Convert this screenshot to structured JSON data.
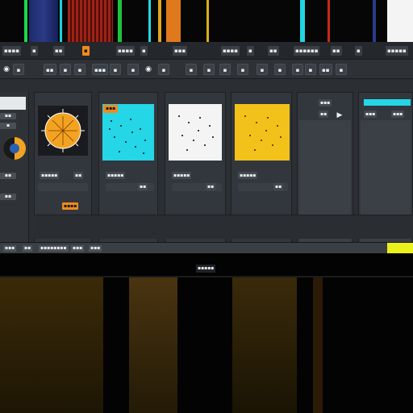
{
  "menubar": {
    "items": [
      "▪▪▪▪",
      "▪",
      "▪▪",
      "▪",
      "▪▪▪▪",
      "▪",
      "▪▪▪",
      "▪▪▪▪",
      "▪",
      "▪▪",
      "▪▪▪▪▪▪",
      "▪▪",
      "▪",
      "▪▪▪▪▪"
    ]
  },
  "toolbar": {
    "buttons": [
      "◉",
      "▪",
      "▪▪",
      "▪",
      "▪",
      "▪▪▪",
      "▪",
      "▪",
      "◉",
      "▪",
      "▪",
      "▪",
      "▪",
      "▪",
      "▪",
      "▪",
      "▪",
      "▪",
      "▪▪",
      "▪"
    ]
  },
  "sidebar": {
    "items": [
      "▪▪",
      "▪",
      "▪▪",
      "▪▪"
    ]
  },
  "panels": {
    "p1": {
      "footer_label": "▪▪▪▪▪",
      "footer_value": "▪▪",
      "action_label": "▪▪▪▪"
    },
    "p2": {
      "header_label": "▪▪▪",
      "footer_label": "▪▪▪▪▪",
      "footer_value": "▪▪"
    },
    "p3": {
      "footer_label": "▪▪▪▪▪",
      "footer_value": "▪▪"
    },
    "p4": {
      "footer_label": "▪▪▪▪▪",
      "footer_value": "▪▪"
    },
    "p5": {
      "header_label": "▪▪▪",
      "sub_label": "▪▪"
    },
    "p6": {
      "header_label": "▪▪▪",
      "sub_label": "▪▪▪"
    }
  },
  "statusbar": {
    "items": [
      "▪▪▪",
      "▪▪",
      "▪▪▪▪▪▪▪▪",
      "▪▪▪",
      "▪▪▪"
    ]
  },
  "bottom": {
    "label": "▪▪▪▪▪"
  },
  "colors": {
    "accent_orange": "#f08a1c",
    "accent_cyan": "#25d6e6",
    "accent_yellow": "#f2c21a",
    "accent_lime": "#e9f01a"
  }
}
